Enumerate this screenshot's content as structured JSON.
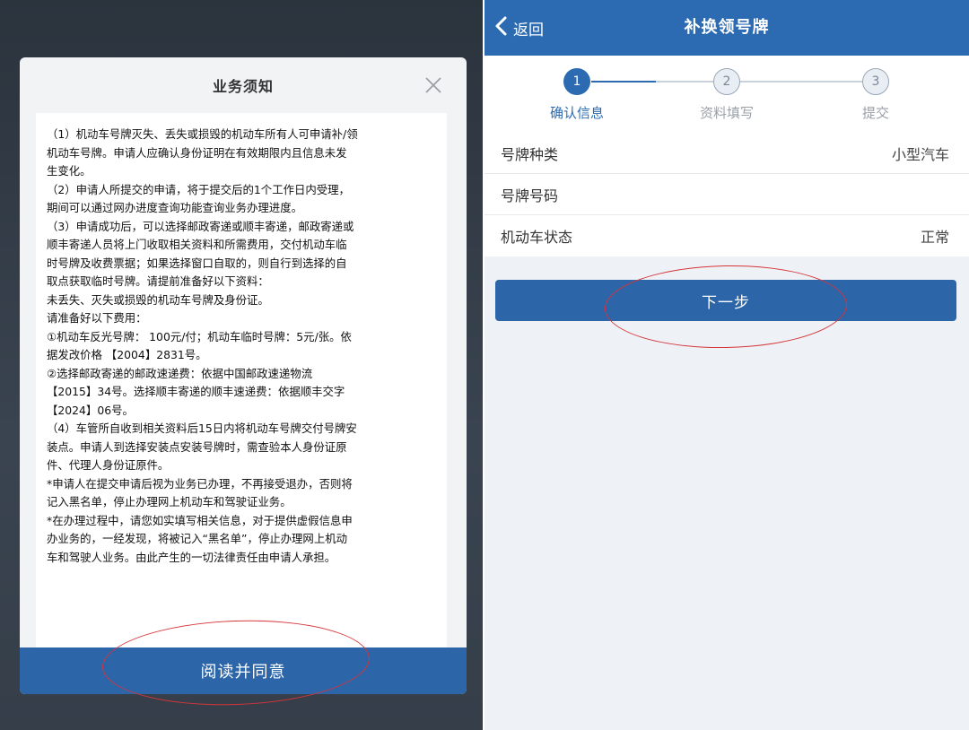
{
  "modal": {
    "title": "业务须知",
    "close_icon": "close-icon",
    "notice_lines": [
      "（1）机动车号牌灭失、丢失或损毁的机动车所有人可申请补/领",
      "机动车号牌。申请人应确认身份证明在有效期限内且信息未发",
      "生变化。",
      "（2）申请人所提交的申请，将于提交后的1个工作日内受理，",
      "期间可以通过网办进度查询功能查询业务办理进度。",
      "（3）申请成功后，可以选择邮政寄递或顺丰寄递，邮政寄递或",
      "顺丰寄递人员将上门收取相关资料和所需费用，交付机动车临",
      "时号牌及收费票据；如果选择窗口自取的，则自行到选择的自",
      "取点获取临时号牌。请提前准备好以下资料：",
      "  未丢失、灭失或损毁的机动车号牌及身份证。",
      "请准备好以下费用：",
      "  ①机动车反光号牌： 100元/付；机动车临时号牌：5元/张。依",
      "据发改价格 【2004】2831号。",
      "  ②选择邮政寄递的邮政速递费：依据中国邮政速递物流",
      "【2015】34号。选择顺丰寄递的顺丰速递费：依据顺丰交字",
      "【2024】06号。",
      "（4）车管所自收到相关资料后15日内将机动车号牌交付号牌安",
      "装点。申请人到选择安装点安装号牌时，需查验本人身份证原",
      "件、代理人身份证原件。",
      "*申请人在提交申请后视为业务已办理，不再接受退办，否则将",
      "记入黑名单，停止办理网上机动车和驾驶证业务。",
      "*在办理过程中，请您如实填写相关信息，对于提供虚假信息申",
      "办业务的，一经发现，将被记入“黑名单”，停止办理网上机动",
      "车和驾驶人业务。由此产生的一切法律责任由申请人承担。"
    ],
    "agree_label": "阅读并同意"
  },
  "right": {
    "nav": {
      "back_label": "返回",
      "title": "补换领号牌",
      "back_icon": "chevron-left-icon"
    },
    "steps": [
      {
        "number": "1",
        "label": "确认信息",
        "active": true
      },
      {
        "number": "2",
        "label": "资料填写",
        "active": false
      },
      {
        "number": "3",
        "label": "提交",
        "active": false
      }
    ],
    "info_rows": [
      {
        "label": "号牌种类",
        "value": "小型汽车"
      },
      {
        "label": "号牌号码",
        "value": ""
      },
      {
        "label": "机动车状态",
        "value": "正常"
      }
    ],
    "next_label": "下一步"
  },
  "colors": {
    "primary": "#2c6bb1",
    "button": "#2c65a8",
    "annotation": "#d6353a"
  }
}
